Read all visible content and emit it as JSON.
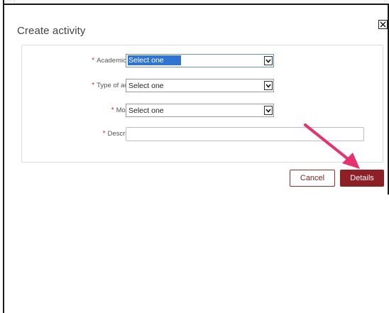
{
  "modal": {
    "title": "Create activity",
    "close_icon": "close-icon"
  },
  "form": {
    "fields": [
      {
        "label": "Academic year",
        "required": true,
        "type": "select",
        "value": "Select one",
        "focused": true
      },
      {
        "label": "Type of activity",
        "required": true,
        "type": "select",
        "value": "Select one",
        "focused": false
      },
      {
        "label": "Modality",
        "required": true,
        "type": "select",
        "value": "Select one",
        "focused": false
      },
      {
        "label": "Description",
        "required": true,
        "type": "text",
        "value": ""
      }
    ],
    "required_marker": "*"
  },
  "actions": {
    "cancel_label": "Cancel",
    "details_label": "Details"
  },
  "colors": {
    "primary_button": "#8e1f24",
    "required_marker": "#c0392b",
    "selection_highlight": "#2f74d0",
    "annotation_arrow": "#e8326e"
  }
}
